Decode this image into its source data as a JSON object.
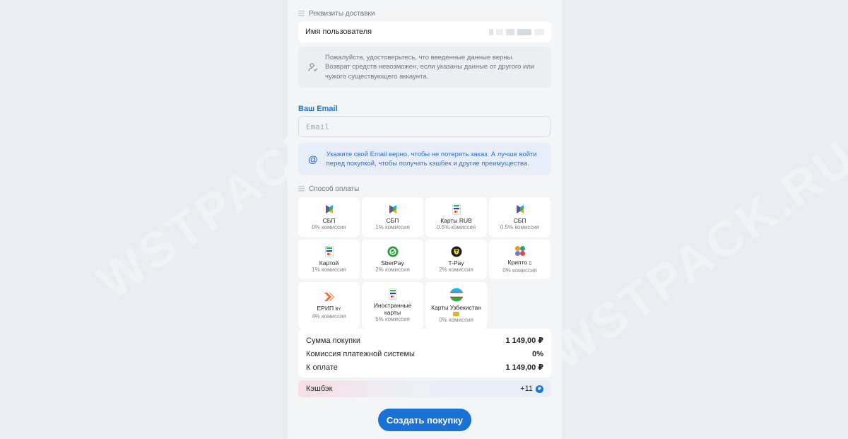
{
  "delivery": {
    "section_label": "Реквизиты доставки",
    "username_label": "Имя пользователя",
    "notice_line1": "Пожалуйста, удостоверьтесь, что введенные данные верны.",
    "notice_line2": "Возврат средств невозможен, если указаны данные от другого или",
    "notice_line3": "чужого существующего аккаунта."
  },
  "email": {
    "label": "Ваш Email",
    "placeholder": "Email",
    "note_line1": "Укажите свой Email верно, чтобы не потерять заказ. А лучше войти",
    "note_line2": "перед покупкой, чтобы получать кэшбек и другие преимущества."
  },
  "payment": {
    "section_label": "Способ оплаты",
    "methods": [
      {
        "name": "СБП",
        "fee": "0% комиссия",
        "icon": "sbp-icon"
      },
      {
        "name": "СБП",
        "fee": "1% комиссия",
        "icon": "sbp-icon"
      },
      {
        "name": "Карты RUB",
        "fee": "0.5% комиссия",
        "icon": "card-icon"
      },
      {
        "name": "СБП",
        "fee": "0.5% комиссия",
        "icon": "sbp-icon"
      },
      {
        "name": "Картой",
        "fee": "1% комиссия",
        "icon": "card-icon"
      },
      {
        "name": "SberPay",
        "fee": "2% комиссия",
        "icon": "sberpay-icon"
      },
      {
        "name": "T-Pay",
        "fee": "2% комиссия",
        "icon": "tpay-icon"
      },
      {
        "name": "Крипто",
        "fee": "0% комиссия",
        "icon": "crypto-icon"
      },
      {
        "name": "ЕРИП",
        "fee": "4% комиссия",
        "icon": "erip-icon"
      },
      {
        "name": "Иностранные карты",
        "fee": "5% комиссия",
        "icon": "card-icon"
      },
      {
        "name": "Карты Узбекистан",
        "fee": "0% комиссия",
        "icon": "uzbekistan-flag-icon"
      }
    ]
  },
  "summary": {
    "purchase_label": "Сумма покупки",
    "purchase_value": "1 149,00 ₽",
    "fee_label": "Комиссия платежной системы",
    "fee_value": "0%",
    "total_label": "К оплате",
    "total_value": "1 149,00 ₽"
  },
  "cashback": {
    "label": "Кэшбэк",
    "value": "+11"
  },
  "submit_label": "Создать покупку",
  "watermark": "WSTPACK.RU",
  "colors": {
    "accent": "#1a72d6",
    "panel_bg": "#f4f5f7",
    "page_bg": "#e9ecf1"
  }
}
